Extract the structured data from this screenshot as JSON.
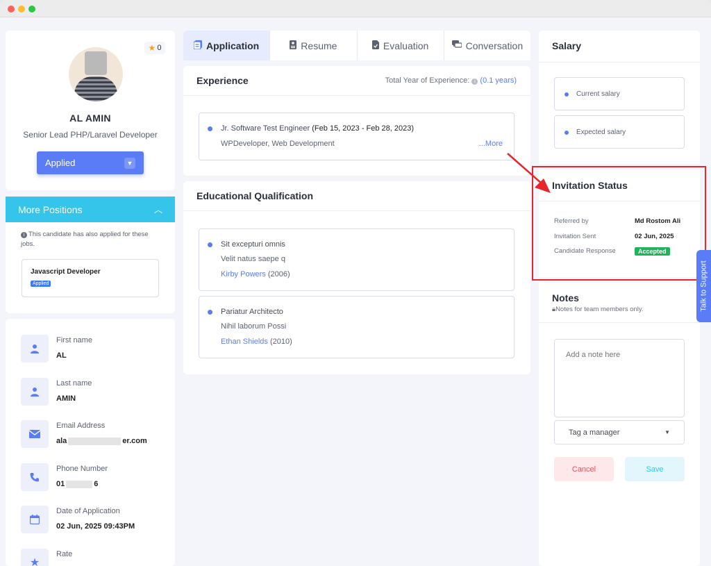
{
  "profile": {
    "rating": "0",
    "name": "AL AMIN",
    "role": "Senior Lead PHP/Laravel Developer",
    "status": "Applied"
  },
  "more_positions": {
    "title": "More Positions",
    "note": "This candidate has also applied for these jobs.",
    "jobs": [
      {
        "title": "Javascript Developer",
        "badge": "Applied"
      }
    ]
  },
  "details": [
    {
      "label": "First name",
      "value": "AL",
      "icon": "user-icon"
    },
    {
      "label": "Last name",
      "value": "AMIN",
      "icon": "user-icon"
    },
    {
      "label": "Email Address",
      "value_start": "ala",
      "value_end": "er.com",
      "icon": "mail-icon"
    },
    {
      "label": "Phone Number",
      "value_start": "01",
      "value_end": "6",
      "icon": "phone-icon"
    },
    {
      "label": "Date of Application",
      "value": "02 Jun, 2025 09:43PM",
      "icon": "calendar-icon"
    },
    {
      "label": "Rate",
      "icon": "star-icon"
    }
  ],
  "tabs": [
    {
      "label": "Application",
      "icon": "document-icon",
      "active": true
    },
    {
      "label": "Resume",
      "icon": "resume-icon",
      "active": false
    },
    {
      "label": "Evaluation",
      "icon": "evaluation-icon",
      "active": false
    },
    {
      "label": "Conversation",
      "icon": "chat-icon",
      "active": false
    }
  ],
  "experience": {
    "title": "Experience",
    "total_label": "Total Year of Experience:",
    "total_value": "(0.1 years)",
    "items": [
      {
        "position": "Jr. Software Test Engineer",
        "dates": "(Feb 15, 2023 - Feb 28, 2023)",
        "company": "WPDeveloper, Web Development",
        "more": "...More"
      }
    ]
  },
  "education": {
    "title": "Educational Qualification",
    "items": [
      {
        "degree": "Sit excepturi omnis",
        "field": "Velit natus saepe q",
        "institute": "Kirby Powers",
        "year": "(2006)"
      },
      {
        "degree": "Pariatur Architecto",
        "field": "Nihil laborum Possi",
        "institute": "Ethan Shields",
        "year": "(2010)"
      }
    ]
  },
  "salary": {
    "title": "Salary",
    "current_label": "Current salary",
    "expected_label": "Expected salary"
  },
  "invitation": {
    "title": "Invitation Status",
    "referred_label": "Referred by",
    "referred_value": "Md Rostom Ali",
    "sent_label": "Invitation Sent",
    "sent_value": "02 Jun, 2025",
    "response_label": "Candidate Response",
    "response_value": "Accepted"
  },
  "notes": {
    "title": "Notes",
    "subtitle": "Notes for team members only.",
    "placeholder": "Add a note here",
    "tag_label": "Tag a manager",
    "cancel_label": "Cancel",
    "save_label": "Save"
  },
  "support_label": "Talk to Support",
  "colors": {
    "accent": "#5b7cf7",
    "cyan": "#35c4ea",
    "success": "#1fb45a",
    "danger": "#f0505c",
    "highlight": "#e6262a"
  }
}
